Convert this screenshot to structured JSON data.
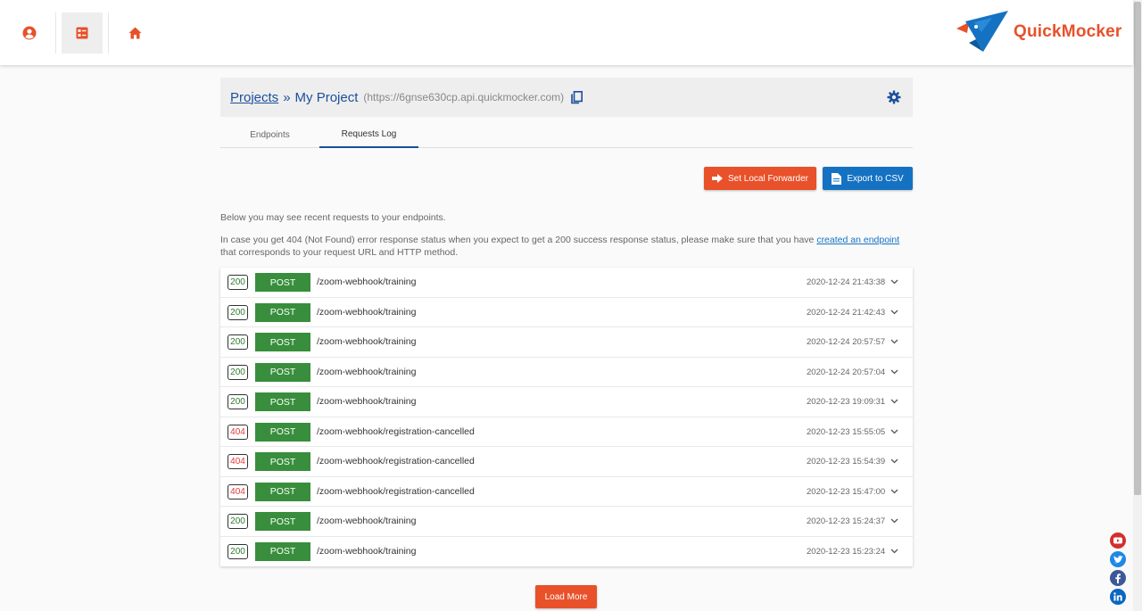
{
  "brand": {
    "name": "QuickMocker",
    "accent": "#e8512a",
    "primary": "#1572c3"
  },
  "nav": {
    "icons": [
      "user-icon",
      "list-icon",
      "home-icon"
    ]
  },
  "project": {
    "breadcrumb_link": "Projects",
    "separator": "»",
    "name": "My Project",
    "url": "(https://6gnse630cp.api.quickmocker.com)"
  },
  "tabs": [
    {
      "label": "Endpoints"
    },
    {
      "label": "Requests Log"
    }
  ],
  "active_tab": "Requests Log",
  "buttons": {
    "forwarder": "Set Local Forwarder",
    "csv": "Export to CSV",
    "load_more": "Load More"
  },
  "info": {
    "line1": "Below you may see recent requests to your endpoints.",
    "line2_before": "In case you get 404 (Not Found) error response status when you expect to get a 200 success response status, please make sure that you have ",
    "line2_link": "created an endpoint",
    "line2_after": " that corresponds to your request URL and HTTP method."
  },
  "requests": [
    {
      "status": "200",
      "method": "POST",
      "path": "/zoom-webhook/training",
      "time": "2020-12-24 21:43:38"
    },
    {
      "status": "200",
      "method": "POST",
      "path": "/zoom-webhook/training",
      "time": "2020-12-24 21:42:43"
    },
    {
      "status": "200",
      "method": "POST",
      "path": "/zoom-webhook/training",
      "time": "2020-12-24 20:57:57"
    },
    {
      "status": "200",
      "method": "POST",
      "path": "/zoom-webhook/training",
      "time": "2020-12-24 20:57:04"
    },
    {
      "status": "200",
      "method": "POST",
      "path": "/zoom-webhook/training",
      "time": "2020-12-23 19:09:31"
    },
    {
      "status": "404",
      "method": "POST",
      "path": "/zoom-webhook/registration-cancelled",
      "time": "2020-12-23 15:55:05"
    },
    {
      "status": "404",
      "method": "POST",
      "path": "/zoom-webhook/registration-cancelled",
      "time": "2020-12-23 15:54:39"
    },
    {
      "status": "404",
      "method": "POST",
      "path": "/zoom-webhook/registration-cancelled",
      "time": "2020-12-23 15:47:00"
    },
    {
      "status": "200",
      "method": "POST",
      "path": "/zoom-webhook/training",
      "time": "2020-12-23 15:24:37"
    },
    {
      "status": "200",
      "method": "POST",
      "path": "/zoom-webhook/training",
      "time": "2020-12-23 15:23:24"
    }
  ],
  "social": [
    "youtube-icon",
    "twitter-icon",
    "facebook-icon",
    "linkedin-icon"
  ]
}
